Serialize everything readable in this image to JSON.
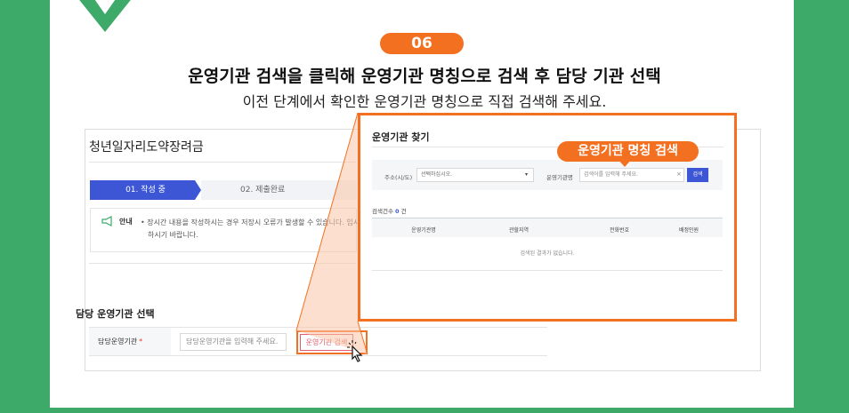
{
  "step_number": "06",
  "headline": "운영기관 검색을 클릭해 운영기관 명칭으로 검색 후 담당 기관 선택",
  "subline": "이전 단계에서 확인한 운영기관 명칭으로 직접 검색해 주세요.",
  "page": {
    "title": "청년일자리도약장려금",
    "steps": [
      "01. 작성 중",
      "02. 제출완료"
    ],
    "notice": {
      "label": "안내",
      "line1": "• 장시간 내용을 작성하시는 경우 저장시 오류가 발생할 수 있습니다. 임시",
      "line2": "하시기 바랍니다."
    },
    "section_title": "담당 운영기관 선택",
    "form": {
      "label": "담당운영기관",
      "required_mark": "*",
      "placeholder": "담당운영기관을 입력해 주세요.",
      "search_button": "운영기관 검색"
    }
  },
  "modal": {
    "title": "운영기관 찾기",
    "callout": "운영기관 명칭 검색",
    "filter": {
      "region_label": "주소(시/도)",
      "region_select": "선택하십시오.",
      "name_label": "운영기관명",
      "name_placeholder": "검색어를 입력해 주세요.",
      "clear": "×",
      "search_button": "검색"
    },
    "result_count_label": "검색건수",
    "result_count_value": "0",
    "result_count_unit": "건",
    "columns": [
      "운영기관명",
      "관할지역",
      "전화번호",
      "배정인원"
    ],
    "empty_message": "검색된 결과가 없습니다."
  },
  "colors": {
    "accent_orange": "#f37021",
    "brand_green": "#3daa6a",
    "primary_blue": "#3c56d6"
  }
}
